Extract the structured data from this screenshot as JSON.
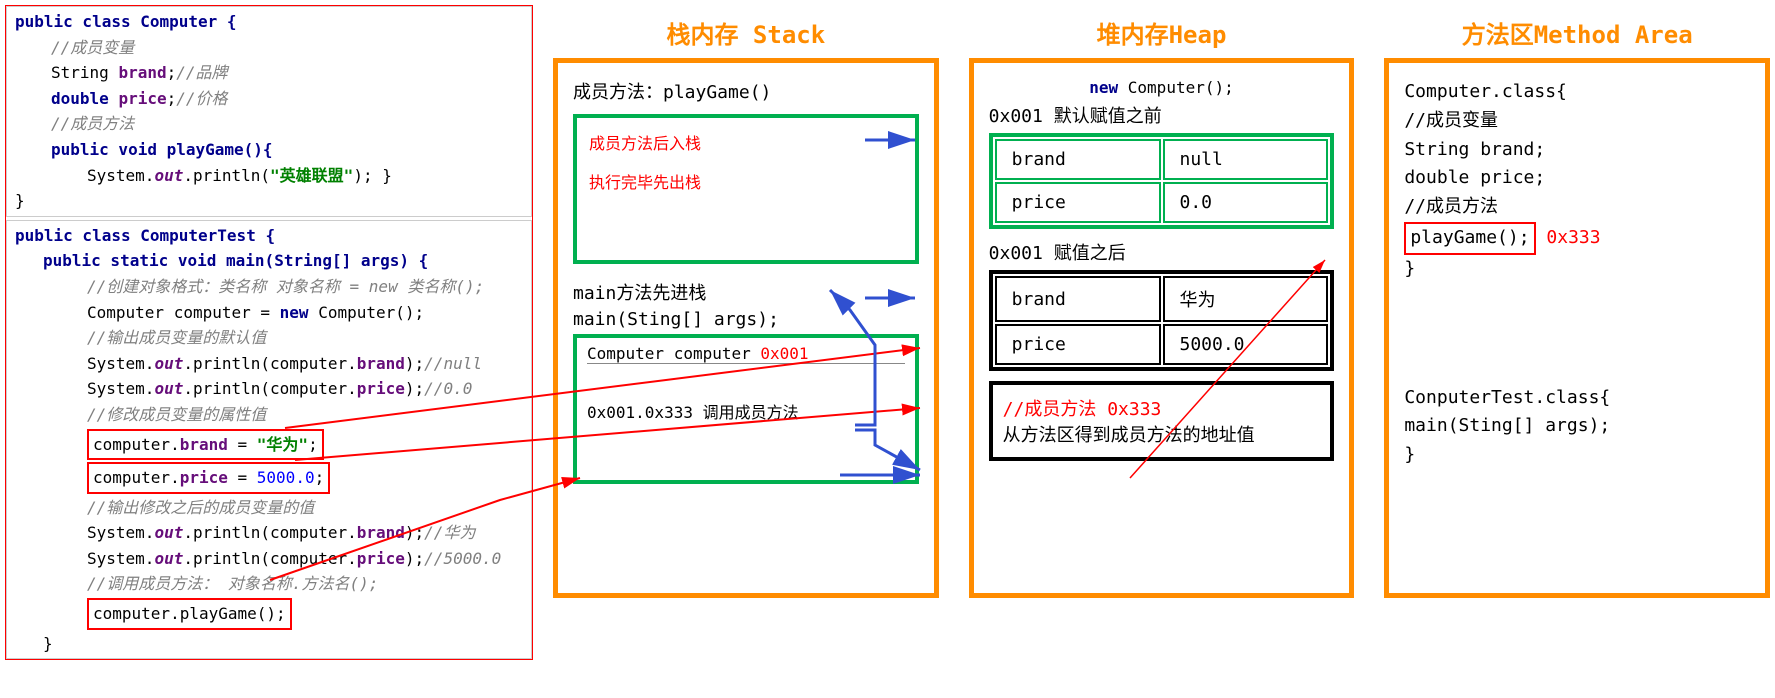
{
  "code": {
    "class1": {
      "decl": "public class Computer {",
      "c1": "//成员变量",
      "l2a": "String ",
      "l2b": "brand",
      "l2c": ";",
      "c2": "//品牌",
      "l3a": "double ",
      "l3b": "price",
      "l3c": ";",
      "c3": "//价格",
      "c4": "//成员方法",
      "l4": "public void playGame(){",
      "l5a": "System.",
      "l5b": "out",
      "l5c": ".println(",
      "l5d": "\"英雄联盟\"",
      "l5e": ");  }",
      "close": "}"
    },
    "class2": {
      "decl": "public class ComputerTest {",
      "main": "public static void main(String[] args) {",
      "c1": "//创建对象格式：类名称 对象名称 = new 类名称();",
      "l1a": "Computer computer = ",
      "l1b": "new ",
      "l1c": "Computer();",
      "c2": "//输出成员变量的默认值",
      "l2a": "System.",
      "l2b": "out",
      "l2c": ".println(computer.",
      "l2d": "brand",
      "l2e": ");",
      "c2e": "//null",
      "l3a": "System.",
      "l3b": "out",
      "l3c": ".println(computer.",
      "l3d": "price",
      "l3e": ");",
      "c3e": "//0.0",
      "c4": "//修改成员变量的属性值",
      "l4a": "computer.",
      "l4b": "brand",
      "l4c": " = ",
      "l4d": "\"华为\"",
      "l4e": ";",
      "l5a": "computer.",
      "l5b": "price",
      "l5c": " = ",
      "l5d": "5000.0",
      "l5e": ";",
      "c6": "//输出修改之后的成员变量的值",
      "l6a": "System.",
      "l6b": "out",
      "l6c": ".println(computer.",
      "l6d": "brand",
      "l6e": ");",
      "c6e": "//华为",
      "l7a": "System.",
      "l7b": "out",
      "l7c": ".println(computer.",
      "l7d": "price",
      "l7e": ");",
      "c7e": "//5000.0",
      "c8": "//调用成员方法： 对象名称.方法名();",
      "l8": "computer.playGame();",
      "close": "}"
    }
  },
  "stack": {
    "title": "栈内存 Stack",
    "method_label": "成员方法：playGame()",
    "note1": "成员方法后入栈",
    "note2": "执行完毕先出栈",
    "main_first": "main方法先进栈",
    "main_sig": "main(Sting[] args);",
    "comp_var": "Computer computer ",
    "addr1": "0x001",
    "call_line": "0x001.0x333 调用成员方法"
  },
  "heap": {
    "title": "堆内存Heap",
    "new_kw": "new ",
    "new_call": "Computer();",
    "before": "0x001 默认赋值之前",
    "tbl1": {
      "r1c1": "brand",
      "r1c2": "null",
      "r2c1": "price",
      "r2c2": "0.0"
    },
    "after": "0x001 赋值之后",
    "tbl2": {
      "r1c1": "brand",
      "r1c2": "华为",
      "r2c1": "price",
      "r2c2": "5000.0"
    },
    "method_c": "//成员方法  ",
    "method_addr": "0x333",
    "method_note": "从方法区得到成员方法的地址值"
  },
  "method_area": {
    "title": "方法区Method Area",
    "cls1_head": "Computer.class{",
    "cls1_c1": " //成员变量",
    "cls1_l1": " String brand;",
    "cls1_l2": " double price;",
    "cls1_c2": " //成员方法",
    "cls1_l3": " playGame(); ",
    "cls1_addr": "0x333",
    "cls1_close": "}",
    "cls2_head": "ConputerTest.class{",
    "cls2_l1": "  main(Sting[] args);",
    "cls2_close": "}"
  }
}
